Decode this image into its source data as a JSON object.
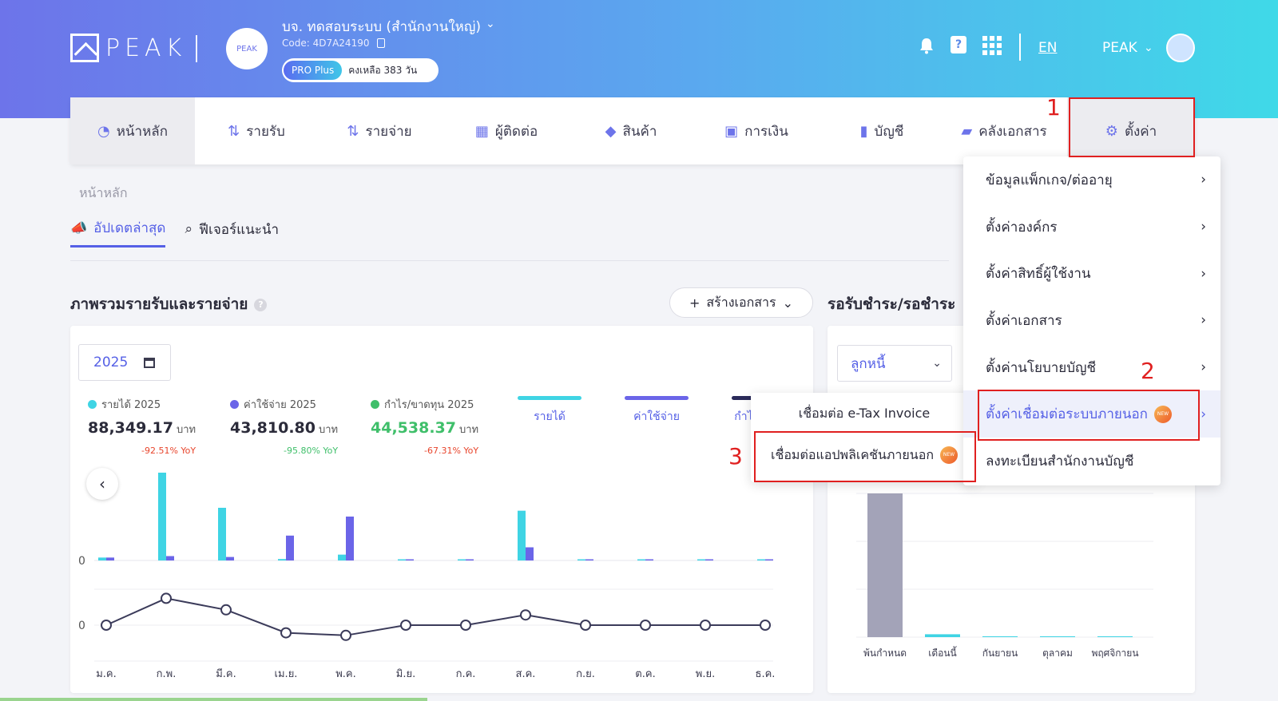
{
  "header": {
    "logo_text": "PEAK",
    "company_name": "บจ. ทดสอบระบบ (สำนักงานใหญ่)",
    "company_code": "Code: 4D7A24190",
    "avatar_text": "PEAK",
    "package_badge": "PRO Plus",
    "package_remaining": "คงเหลือ 383 วัน",
    "language": "EN",
    "user_name": "PEAK"
  },
  "nav": [
    {
      "label": "หน้าหลัก",
      "icon": "dashboard-icon"
    },
    {
      "label": "รายรับ",
      "icon": "income-icon"
    },
    {
      "label": "รายจ่าย",
      "icon": "expense-icon"
    },
    {
      "label": "ผู้ติดต่อ",
      "icon": "contacts-icon"
    },
    {
      "label": "สินค้า",
      "icon": "box-icon"
    },
    {
      "label": "การเงิน",
      "icon": "money-icon"
    },
    {
      "label": "บัญชี",
      "icon": "book-icon"
    },
    {
      "label": "คลังเอกสาร",
      "icon": "folder-icon"
    },
    {
      "label": "ตั้งค่า",
      "icon": "gear-icon"
    }
  ],
  "breadcrumb": "หน้าหลัก",
  "subtabs": [
    "อัปเดตล่าสุด",
    "ฟีเจอร์แนะนำ"
  ],
  "section_title": "ภาพรวมรายรับและรายจ่าย",
  "create_button": "สร้างเอกสาร",
  "section2_title": "รอรับชำระ/รอชำระ",
  "year": "2025",
  "stats": [
    {
      "label": "รายได้ 2025",
      "value": "88,349.17",
      "unit": "บาท",
      "yoy": "-92.51% YoY",
      "color": "#3fd4e4"
    },
    {
      "label": "ค่าใช้จ่าย 2025",
      "value": "43,810.80",
      "unit": "บาท",
      "yoy": "-95.80% YoY",
      "color": "#6b65e8"
    },
    {
      "label": "กำไร/ขาดทุน 2025",
      "value": "44,538.37",
      "unit": "บาท",
      "yoy": "-67.31% YoY",
      "color": "#3fbf6a"
    }
  ],
  "legend": [
    "รายได้",
    "ค่าใช้จ่าย",
    "กำไ"
  ],
  "chart_data": {
    "type": "bar",
    "categories": [
      "ม.ค.",
      "ก.พ.",
      "มี.ค.",
      "เม.ย.",
      "พ.ค.",
      "มิ.ย.",
      "ก.ค.",
      "ส.ค.",
      "ก.ย.",
      "ต.ค.",
      "พ.ย.",
      "ธ.ค."
    ],
    "series": [
      {
        "name": "รายได้",
        "values": [
          1,
          30,
          18,
          0.5,
          2,
          0.3,
          0.3,
          17,
          0.2,
          0.2,
          0.2,
          0.2
        ]
      },
      {
        "name": "ค่าใช้จ่าย",
        "values": [
          1,
          1.5,
          1.2,
          8.5,
          15,
          0.3,
          0.3,
          4.5,
          0.2,
          0.2,
          0.2,
          0.2
        ]
      }
    ],
    "profit_line": [
      0,
      10.5,
      6,
      -3,
      -4,
      0,
      0,
      4,
      0,
      0,
      0,
      0
    ],
    "ytick_label": "0"
  },
  "chart2": {
    "dropdown": "ลูกหนี้",
    "categories": [
      "พ้นกำหนด",
      "เดือนนี้",
      "กันยายน",
      "ตุลาคม",
      "พฤศจิกายน"
    ],
    "values": [
      100,
      2,
      0.3,
      0.3,
      0.3
    ]
  },
  "settings_menu": [
    "ข้อมูลแพ็กเกจ/ต่ออายุ",
    "ตั้งค่าองค์กร",
    "ตั้งค่าสิทธิ์ผู้ใช้งาน",
    "ตั้งค่าเอกสาร",
    "ตั้งค่านโยบายบัญชี",
    "ตั้งค่าเชื่อมต่อระบบภายนอก",
    "ลงทะเบียนสำนักงานบัญชี"
  ],
  "submenu": [
    "เชื่อมต่อ e-Tax Invoice",
    "เชื่อมต่อแอปพลิเคชันภายนอก"
  ],
  "new_badge": "NEW",
  "annotations": [
    "1",
    "2",
    "3"
  ]
}
